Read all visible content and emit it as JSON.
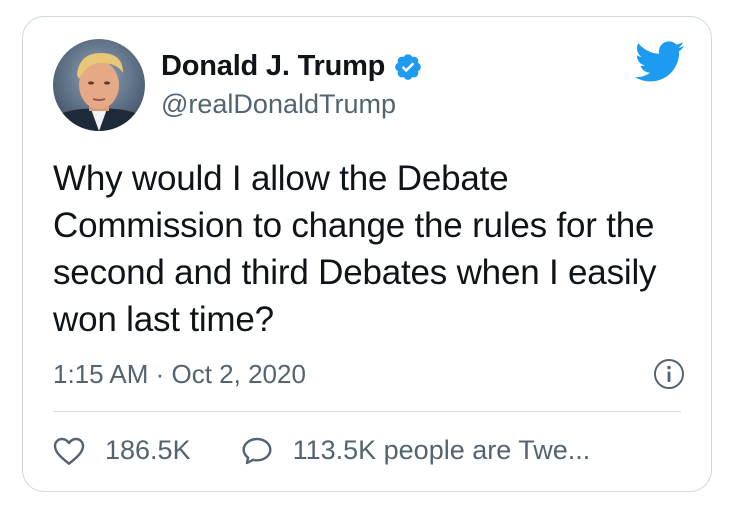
{
  "tweet": {
    "author": {
      "name": "Donald J. Trump",
      "handle": "@realDonaldTrump",
      "verified_icon": "verified-badge-icon"
    },
    "text": "Why would I allow the Debate Commission to change the rules for the second and third Debates when I easily won last time?",
    "timestamp": "1:15 AM · Oct 2, 2020",
    "likes": "186.5K",
    "replies_label": "113.5K people are Twe..."
  },
  "icons": {
    "brand": "twitter-bird-icon",
    "info": "info-icon",
    "like": "heart-icon",
    "reply": "speech-bubble-icon"
  },
  "colors": {
    "brand_blue": "#1d9bf0",
    "text_primary": "#0f1419",
    "text_secondary": "#536471",
    "border": "#cfd9de"
  }
}
